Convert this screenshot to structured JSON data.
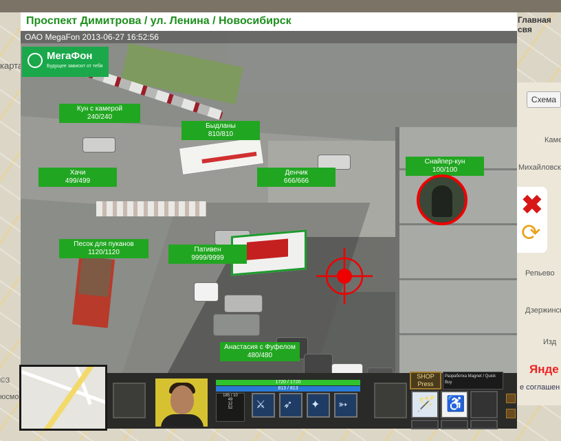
{
  "background_page": {
    "map_label": "карта",
    "right_link": "Главная свя",
    "scheme_button": "Схема",
    "place_names": [
      "Каме",
      "Михайловск",
      "Репьево",
      "Дзержинск",
      "Изд"
    ],
    "copyright": "©3",
    "terms_link": "е соглашен",
    "yandex_label": "Янде",
    "bottom_left_text": "юсмо"
  },
  "window": {
    "title": "Проспект Димитрова / ул. Ленина / Новосибирск"
  },
  "camera": {
    "provider_timestamp": "ОАО MegaFon 2013-06-27 16:52:56",
    "logo_name": "МегаФон",
    "logo_tagline": "Будущее зависит от тебя"
  },
  "targets": [
    {
      "name": "Кун с камерой",
      "hp": "240/240"
    },
    {
      "name": "Быдланы",
      "hp": "810/810"
    },
    {
      "name": "Хачи",
      "hp": "499/499"
    },
    {
      "name": "Денчик",
      "hp": "666/666"
    },
    {
      "name": "Снайпер-кун",
      "hp": "100/100"
    },
    {
      "name": "Песок для пуканов",
      "hp": "1120/1120"
    },
    {
      "name": "Пативен",
      "hp": "9999/9999"
    },
    {
      "name": "Анастасия с Фуфелом",
      "hp": "480/480"
    }
  ],
  "side_controls": {
    "close_icon": "close-icon",
    "refresh_icon": "refresh-icon"
  },
  "hud": {
    "hp_text": "1720 / 1720",
    "hp_fraction": 1.0,
    "mana_text": "813 / 813",
    "mana_fraction": 1.0,
    "stats_text": [
      "185 / 10",
      "49",
      "12",
      "52"
    ],
    "skill_icons": [
      "sword-icon",
      "blade-icon",
      "orb-icon",
      "arrow-icon"
    ],
    "shop_label": "SHOP",
    "shop_subtitle": "Press",
    "shop_info": "Разработка Magnet / Quick Buy",
    "inventory_icons": [
      "staff-icon",
      "wheelchair-icon"
    ],
    "colors": {
      "hp": "#2fc32f",
      "mana": "#2a7ad4",
      "tag": "#21a621",
      "title": "#1d8f1d",
      "target_ring": "#e00000"
    }
  }
}
